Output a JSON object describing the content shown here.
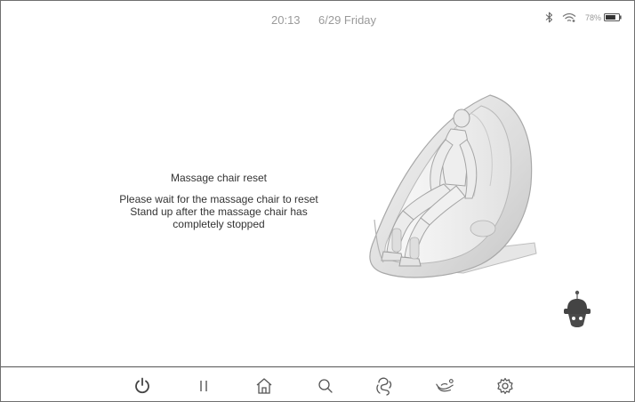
{
  "status": {
    "time": "20:13",
    "date": "6/29 Friday",
    "battery": "78%",
    "battery_level": 0.78,
    "icons": [
      "bluetooth-icon",
      "wifi-icon",
      "battery-icon"
    ]
  },
  "message": {
    "title": "Massage chair reset",
    "lines": [
      "Please wait for the massage chair to reset",
      "Stand up after the massage chair has",
      "completely stopped"
    ]
  },
  "nav": {
    "items": [
      {
        "name": "power-icon"
      },
      {
        "name": "pause-icon"
      },
      {
        "name": "home-icon"
      },
      {
        "name": "search-icon"
      },
      {
        "name": "massage-hand-icon"
      },
      {
        "name": "recline-icon"
      },
      {
        "name": "settings-gear-icon"
      }
    ]
  },
  "colors": {
    "text": "#333333",
    "status_text": "#9a9a9a",
    "icon": "#555555",
    "border": "#6f6f6f"
  }
}
